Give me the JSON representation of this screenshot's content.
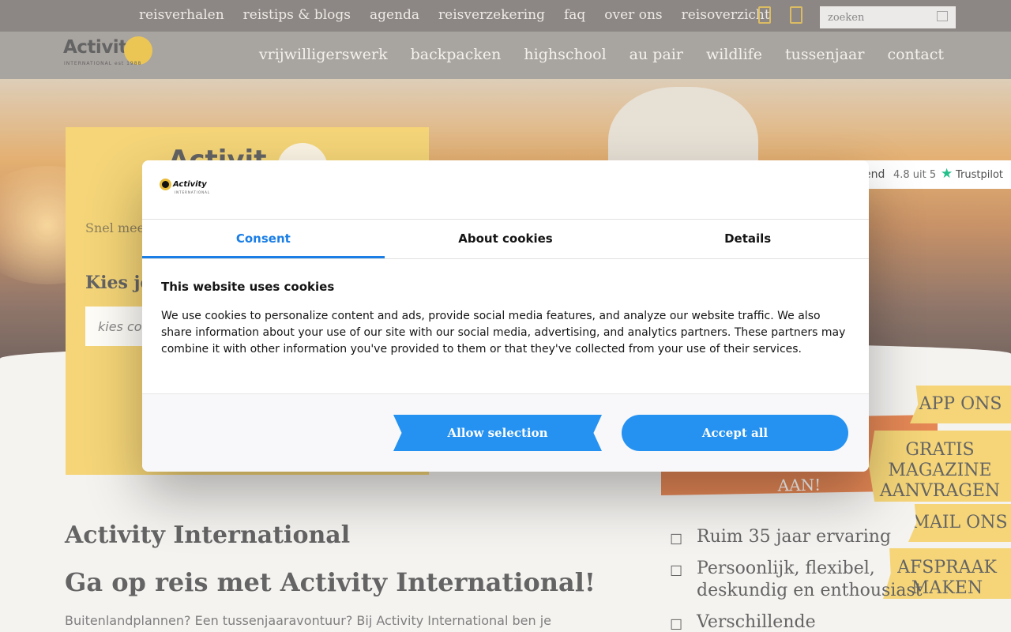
{
  "topbar": {
    "links": [
      "reisverhalen",
      "reistips & blogs",
      "agenda",
      "reisverzekering",
      "faq",
      "over ons",
      "reisoverzicht"
    ],
    "search_placeholder": "zoeken"
  },
  "header": {
    "logo_text": "Activity",
    "logo_sub": "INTERNATIONAL est 1988",
    "nav": [
      "vrijwilligerswerk",
      "backpacken",
      "highschool",
      "au pair",
      "wildlife",
      "tussenjaar",
      "contact"
    ]
  },
  "trustpilot": {
    "label_partial": "end",
    "rating": "4.8 uit 5",
    "brand": "Trustpilot"
  },
  "search_card": {
    "brand": "Activit",
    "intro": "Snel meer informatie over jouw bestemming",
    "heading": "Kies je",
    "input_placeholder": "kies co"
  },
  "cta": {
    "bottom_text": "AAN!"
  },
  "side_tabs": {
    "app": "APP ONS",
    "magazine": "GRATIS MAGAZINE AANVRAGEN",
    "mail": "MAIL ONS",
    "afspraak": "AFSPRAAK MAKEN"
  },
  "content": {
    "h1": "Activity International",
    "h2": "Ga op reis met Activity International!",
    "lead": "Buitenlandplannen? Een tussenjaaravontuur? Bij Activity International ben je"
  },
  "usps": [
    "Ruim 35 jaar ervaring",
    "Persoonlijk, flexibel, deskundig en enthousiast",
    "Verschillende"
  ],
  "cookie_modal": {
    "logo_text": "Activity",
    "logo_sub": "INTERNATIONAL",
    "tabs": [
      "Consent",
      "About cookies",
      "Details"
    ],
    "active_tab": "Consent",
    "title": "This website uses cookies",
    "body": "We use cookies to personalize content and ads, provide social media features, and analyze our website traffic. We also share information about your use of our site with our social media, advertising, and analytics partners. These partners may combine it with other information you've provided to them or that they've collected from your use of their services.",
    "allow_selection": "Allow selection",
    "accept_all": "Accept all",
    "accent_color": "#2592f1"
  }
}
